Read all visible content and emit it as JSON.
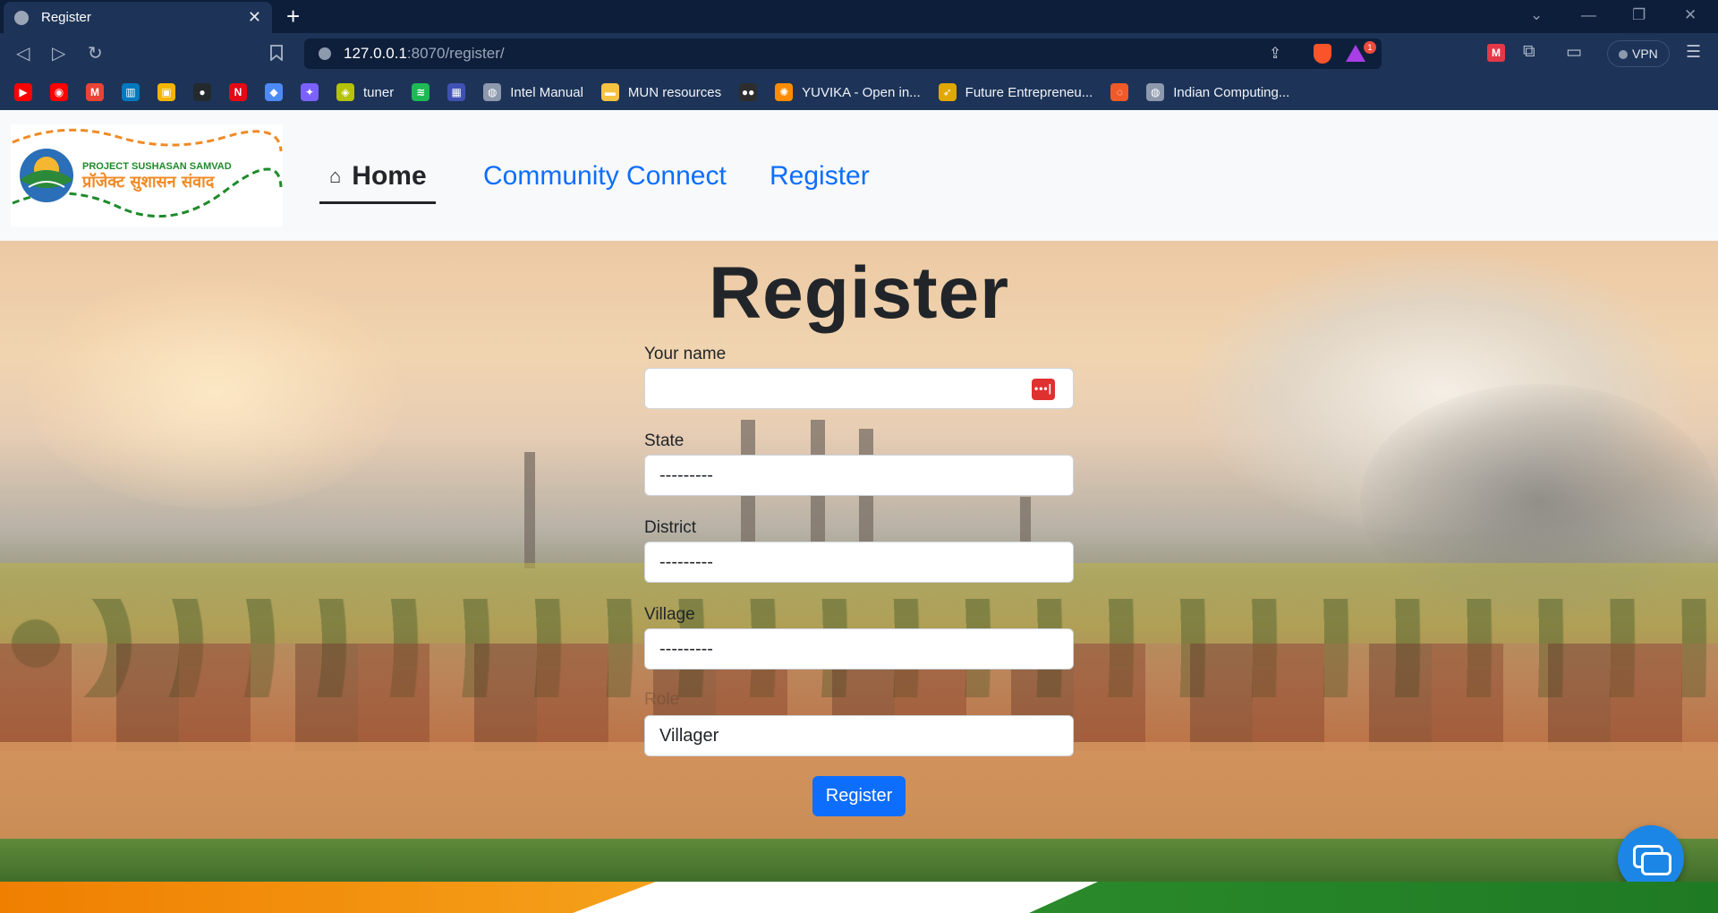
{
  "browser": {
    "tab_title": "Register",
    "tab_close": "✕",
    "new_tab": "+",
    "window_controls": [
      "⌄",
      "—",
      "❐",
      "✕"
    ],
    "nav": {
      "back": "◁",
      "forward": "▷",
      "reload": "↻",
      "bookmark": "🔖"
    },
    "url": {
      "host": "127.0.0.1",
      "rest": ":8070/register/"
    },
    "share_icon": "⇪",
    "rewards_badge": "1",
    "extensions": [
      "puzzle-icon",
      "wallet-icon"
    ],
    "vpn_label": "VPN",
    "menu_icon": "☰",
    "bookmarks": [
      {
        "label": "",
        "icon": "youtube-icon",
        "color": "#ff0000",
        "glyph": "▶"
      },
      {
        "label": "",
        "icon": "youtube-music-icon",
        "color": "#ff0000",
        "glyph": "◉"
      },
      {
        "label": "",
        "icon": "gmail-icon",
        "color": "#ea4335",
        "glyph": "M"
      },
      {
        "label": "",
        "icon": "trello-icon",
        "color": "#0079bf",
        "glyph": "▥"
      },
      {
        "label": "",
        "icon": "google-classroom-icon",
        "color": "#f4b400",
        "glyph": "▣"
      },
      {
        "label": "",
        "icon": "github-icon",
        "color": "#24292e",
        "glyph": "●"
      },
      {
        "label": "",
        "icon": "netflix-icon",
        "color": "#e50914",
        "glyph": "N"
      },
      {
        "label": "",
        "icon": "learning-icon",
        "color": "#4c8bf5",
        "glyph": "◆"
      },
      {
        "label": "",
        "icon": "gemini-icon",
        "color": "#7b61ff",
        "glyph": "✦"
      },
      {
        "label": "tuner",
        "icon": "shield-icon",
        "color": "#b5c20a",
        "glyph": "◈"
      },
      {
        "label": "",
        "icon": "spotify-icon",
        "color": "#1db954",
        "glyph": "≋"
      },
      {
        "label": "",
        "icon": "grid-app-icon",
        "color": "#3f51b5",
        "glyph": "▦"
      },
      {
        "label": "Intel Manual",
        "icon": "globe-icon",
        "color": "#8d99ad",
        "glyph": "◍"
      },
      {
        "label": "MUN resources",
        "icon": "folder-icon",
        "color": "#f5c242",
        "glyph": "▬"
      },
      {
        "label": "",
        "icon": "dots-app-icon",
        "color": "#2d2d2d",
        "glyph": "●●"
      },
      {
        "label": "YUVIKA - Open in...",
        "icon": "isro-icon",
        "color": "#ff8c00",
        "glyph": "✺"
      },
      {
        "label": "Future Entrepreneu...",
        "icon": "wings-icon",
        "color": "#e0a800",
        "glyph": "➶"
      },
      {
        "label": "",
        "icon": "power-icon",
        "color": "#f05a28",
        "glyph": "◌"
      },
      {
        "label": "Indian Computing...",
        "icon": "globe-icon",
        "color": "#8d99ad",
        "glyph": "◍"
      }
    ]
  },
  "site": {
    "logo_text_en": "PROJECT SUSHASAN SAMVAD",
    "logo_text_hi": "प्रॉजेक्ट सुशासन संवाद",
    "menu": [
      {
        "label": "Home",
        "icon": "⌂",
        "active": true
      },
      {
        "label": "Community Connect",
        "active": false
      },
      {
        "label": "Register",
        "active": false
      }
    ]
  },
  "form": {
    "title": "Register",
    "fields": [
      {
        "label": "Your name",
        "value": "",
        "type": "text"
      },
      {
        "label": "State",
        "value": "---------",
        "type": "select"
      },
      {
        "label": "District",
        "value": "---------",
        "type": "select"
      },
      {
        "label": "Village",
        "value": "---------",
        "type": "select"
      },
      {
        "label": "Role",
        "value": "Villager",
        "type": "select"
      }
    ],
    "password_manager_icon": "•••|",
    "submit_label": "Register"
  },
  "colors": {
    "primary": "#0d6efd",
    "saffron": "#f07f00",
    "green": "#1f7a24"
  }
}
